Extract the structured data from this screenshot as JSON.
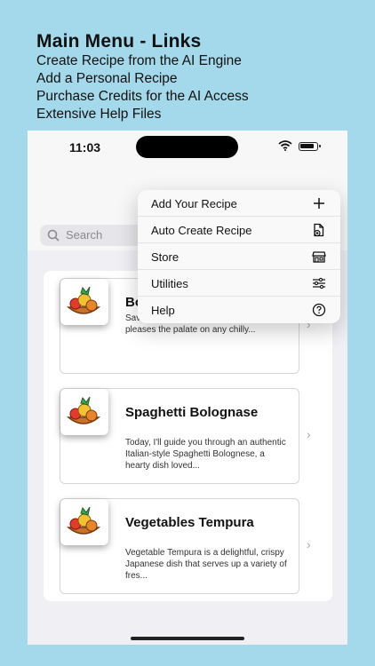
{
  "promo": {
    "title": "Main Menu - Links",
    "lines": [
      "Create Recipe from the AI Engine",
      "Add a Personal Recipe",
      "Purchase Credits for the AI Access",
      "Extensive Help Files"
    ]
  },
  "status_bar": {
    "time": "11:03"
  },
  "search": {
    "placeholder": "Search"
  },
  "menu": {
    "items": [
      {
        "label": "Add Your Recipe",
        "icon": "plus-icon"
      },
      {
        "label": "Auto Create Recipe",
        "icon": "document-add-icon"
      },
      {
        "label": "Store",
        "icon": "storefront-icon"
      },
      {
        "label": "Utilities",
        "icon": "sliders-icon"
      },
      {
        "label": "Help",
        "icon": "question-circle-icon"
      }
    ]
  },
  "recipes": [
    {
      "title": "Bo",
      "description": "Sav classic that warms the soul and pleases the palate on any chilly..."
    },
    {
      "title": "Spaghetti Bolognase",
      "description": "Today, I'll guide you through an authentic Italian-style Spaghetti Bolognese, a hearty dish loved..."
    },
    {
      "title": "Vegetables Tempura",
      "description": "Vegetable Tempura is a delightful, crispy Japanese dish that serves up a variety of fres..."
    }
  ],
  "colors": {
    "background": "#a3d9ea",
    "accent": "#5a74e0"
  }
}
